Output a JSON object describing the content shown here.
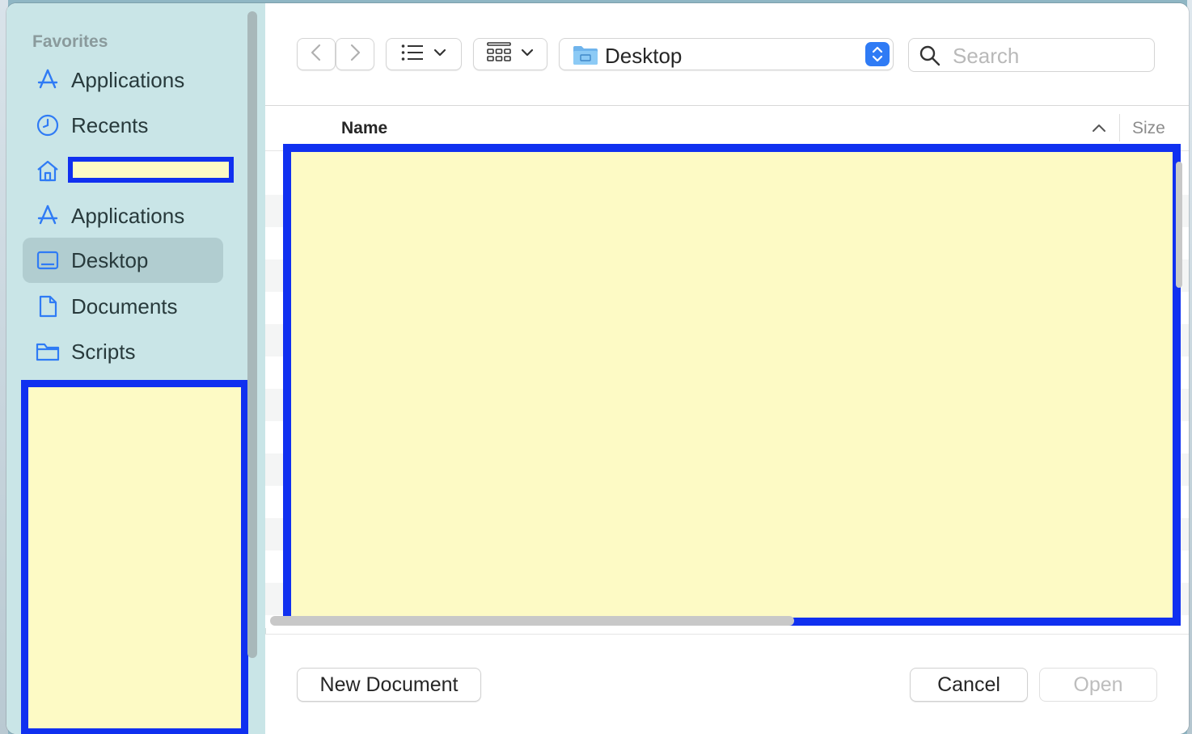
{
  "sidebar": {
    "heading": "Favorites",
    "items": [
      {
        "label": "Applications",
        "icon": "app-store-icon"
      },
      {
        "label": "Recents",
        "icon": "clock-icon"
      },
      {
        "label": "",
        "icon": "home-icon"
      },
      {
        "label": "Applications",
        "icon": "app-store-icon"
      },
      {
        "label": "Desktop",
        "icon": "desktop-icon",
        "selected": true
      },
      {
        "label": "Documents",
        "icon": "document-icon"
      },
      {
        "label": "Scripts",
        "icon": "folder-icon"
      }
    ]
  },
  "toolbar": {
    "location": "Desktop",
    "search_placeholder": "Search"
  },
  "columns": {
    "name": "Name",
    "size": "Size"
  },
  "footer": {
    "new_document": "New Document",
    "cancel": "Cancel",
    "open": "Open"
  },
  "colors": {
    "accent": "#2f7bf5",
    "sidebar_bg": "#c9e5e7",
    "redaction_border": "#1030f0",
    "redaction_fill": "#fdfac5"
  }
}
